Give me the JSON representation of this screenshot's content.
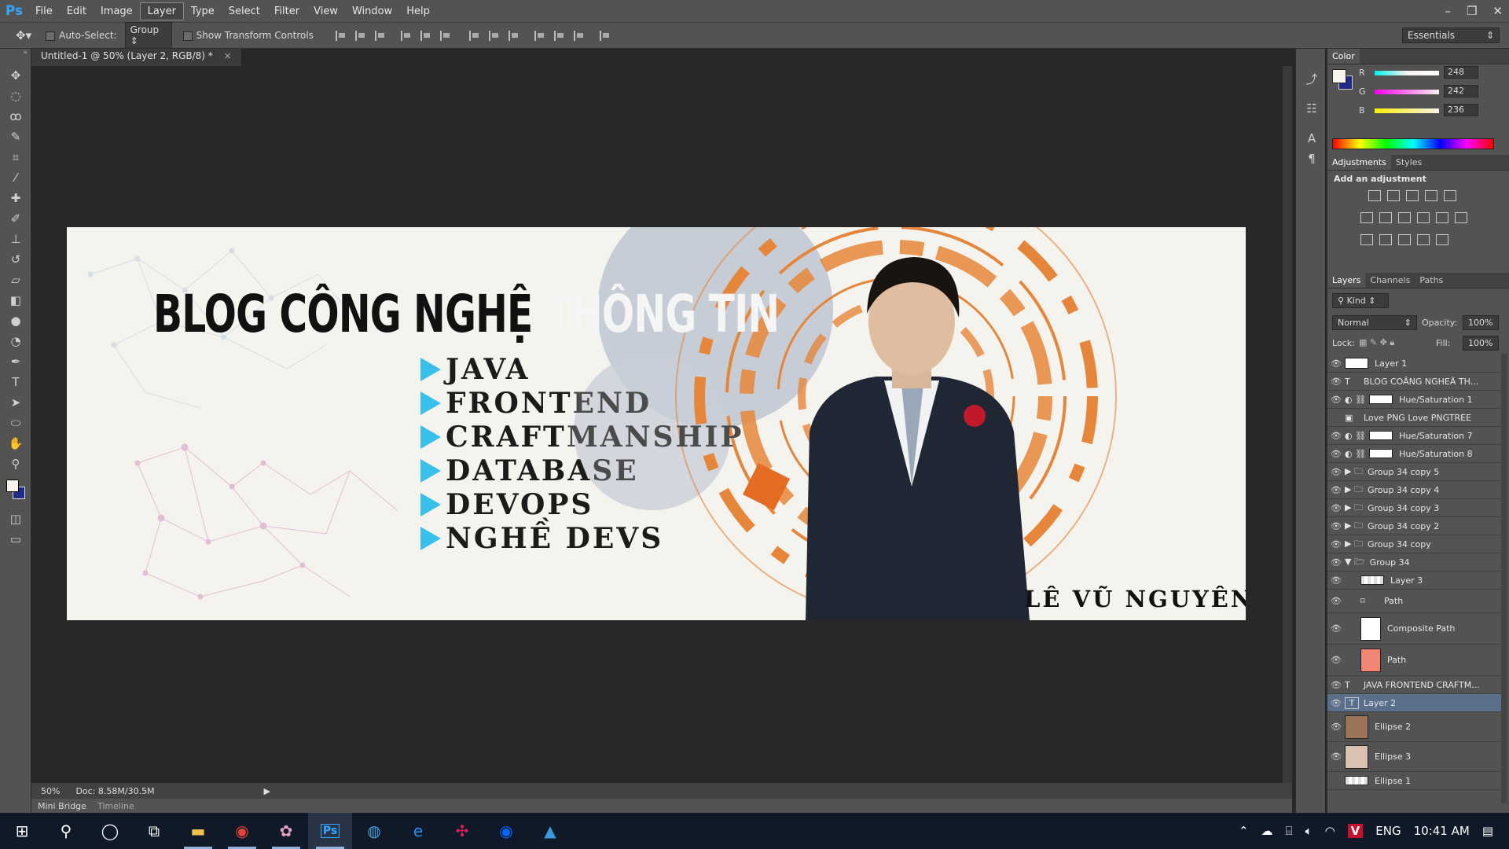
{
  "app": {
    "logo": "Ps"
  },
  "menu": [
    "File",
    "Edit",
    "Image",
    "Layer",
    "Type",
    "Select",
    "Filter",
    "View",
    "Window",
    "Help"
  ],
  "window_controls": [
    "–",
    "❐",
    "✕"
  ],
  "options": {
    "auto_select_label": "Auto-Select:",
    "auto_select_value": "Group",
    "show_transform_label": "Show Transform Controls",
    "workspace": "Essentials"
  },
  "document": {
    "tab_title": "Untitled-1 @ 50% (Layer 2, RGB/8) *",
    "zoom": "50%",
    "doc_size": "Doc: 8.58M/30.5M"
  },
  "bottom_tabs": [
    "Mini Bridge",
    "Timeline"
  ],
  "artwork": {
    "title_dark": "BLOG CÔNG NGHỆ",
    "title_light": "THÔNG TIN",
    "skills": [
      {
        "dark": "JAVA",
        "light": ""
      },
      {
        "dark": "FRONT",
        "light": "END"
      },
      {
        "dark": "CRAFT",
        "light": "MANSHIP"
      },
      {
        "dark": "DATABA",
        "light": "SE"
      },
      {
        "dark": "DEVOPS",
        "light": ""
      },
      {
        "dark": "NGHỀ DEVS",
        "light": ""
      }
    ],
    "name": "LÊ VŨ NGUYÊN"
  },
  "color_panel": {
    "title": "Color",
    "channels": [
      {
        "label": "R",
        "value": "248"
      },
      {
        "label": "G",
        "value": "242"
      },
      {
        "label": "B",
        "value": "236"
      }
    ]
  },
  "adjustments": {
    "tabs": [
      "Adjustments",
      "Styles"
    ],
    "heading": "Add an adjustment"
  },
  "layers_panel": {
    "tabs": [
      "Layers",
      "Channels",
      "Paths"
    ],
    "filter_kind": "Kind",
    "blend_mode": "Normal",
    "opacity_label": "Opacity:",
    "opacity": "100%",
    "lock_label": "Lock:",
    "fill_label": "Fill:",
    "fill": "100%",
    "layers": [
      {
        "name": "Layer 1",
        "kind": "pixel"
      },
      {
        "name": "BLOG COÂNG NGHEÄ TH...",
        "kind": "text"
      },
      {
        "name": "Hue/Saturation 1",
        "kind": "adjust"
      },
      {
        "name": "Love PNG Love PNGTREE",
        "kind": "smart"
      },
      {
        "name": "Hue/Saturation 7",
        "kind": "adjust"
      },
      {
        "name": "Hue/Saturation 8",
        "kind": "adjust"
      },
      {
        "name": "Group 34 copy 5",
        "kind": "group"
      },
      {
        "name": "Group 34 copy 4",
        "kind": "group"
      },
      {
        "name": "Group 34 copy 3",
        "kind": "group"
      },
      {
        "name": "Group 34 copy 2",
        "kind": "group"
      },
      {
        "name": "Group 34 copy",
        "kind": "group"
      },
      {
        "name": "Group 34",
        "kind": "group-open"
      },
      {
        "name": "Layer 3",
        "kind": "child"
      },
      {
        "name": "Path",
        "kind": "child"
      },
      {
        "name": "Composite Path",
        "kind": "child"
      },
      {
        "name": "Path",
        "kind": "child"
      },
      {
        "name": "JAVA FRONTEND CRAFTM...",
        "kind": "text"
      },
      {
        "name": "Layer 2",
        "kind": "text-selected"
      },
      {
        "name": "Ellipse 2",
        "kind": "shape"
      },
      {
        "name": "Ellipse 3",
        "kind": "shape"
      },
      {
        "name": "Ellipse 1",
        "kind": "shape"
      }
    ]
  },
  "taskbar": {
    "lang": "ENG",
    "time": "10:41 AM"
  }
}
